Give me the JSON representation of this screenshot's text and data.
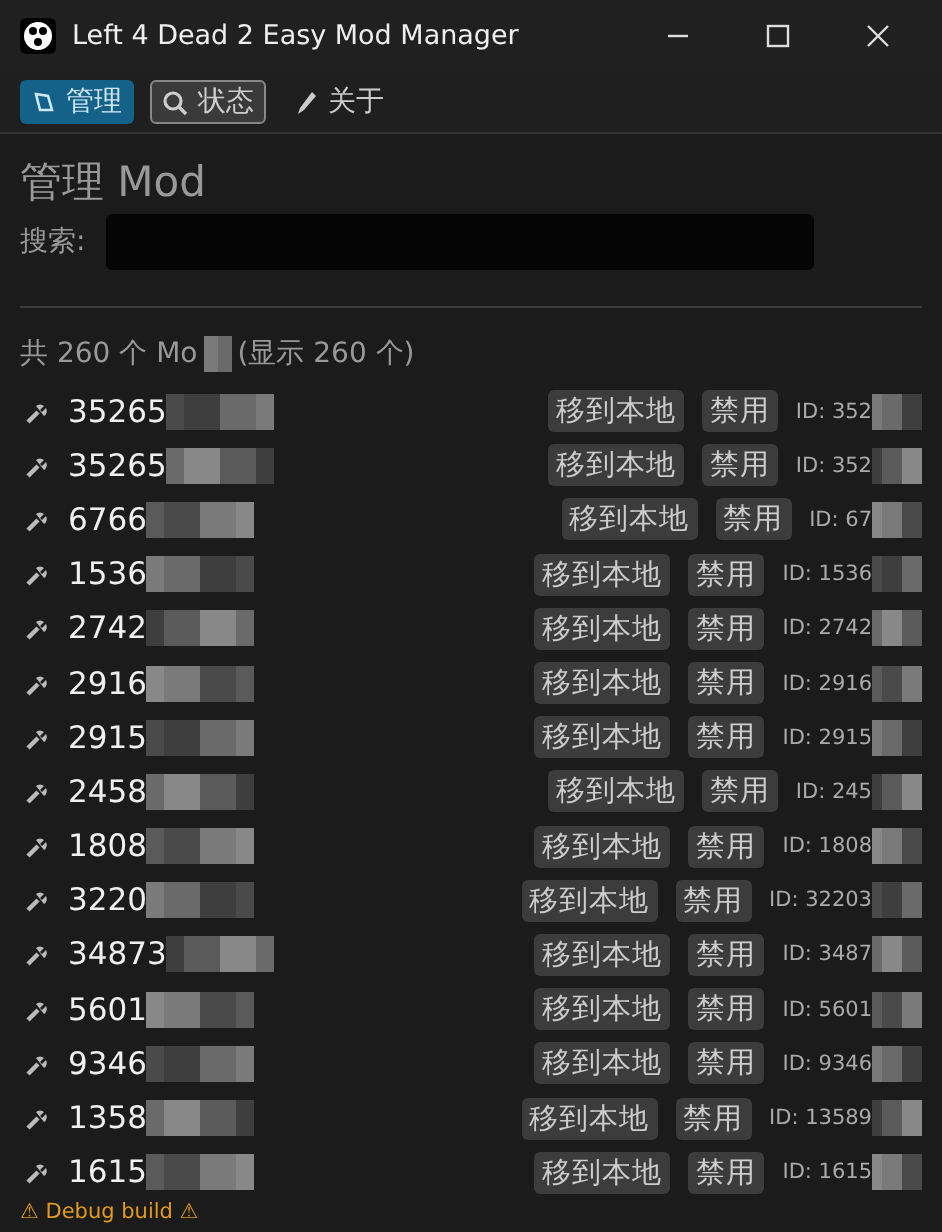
{
  "window": {
    "title": "Left 4 Dead 2 Easy Mod Manager"
  },
  "tabs": [
    {
      "label": "管理",
      "selected": true,
      "focused": false,
      "kind": "folder"
    },
    {
      "label": "状态",
      "selected": false,
      "focused": true,
      "kind": "search"
    },
    {
      "label": "关于",
      "selected": false,
      "focused": false,
      "kind": "pen"
    }
  ],
  "heading": "管理 Mod",
  "search": {
    "label": "搜索:"
  },
  "summary": "共 260 个 Mo",
  "summary_tail": "(显示 260 个)",
  "mods": [
    {
      "name": "35265",
      "move_button": "移到本地",
      "disable_button": "禁用",
      "id": "ID: 352"
    },
    {
      "name": "35265",
      "move_button": "移到本地",
      "disable_button": "禁用",
      "id": "ID: 352"
    },
    {
      "name": "6766",
      "move_button": "移到本地",
      "disable_button": "禁用",
      "id": "ID: 67"
    },
    {
      "name": "1536",
      "move_button": "移到本地",
      "disable_button": "禁用",
      "id": "ID: 1536"
    },
    {
      "name": "2742",
      "move_button": "移到本地",
      "disable_button": "禁用",
      "id": "ID: 2742"
    },
    {
      "name": "2916",
      "move_button": "移到本地",
      "disable_button": "禁用",
      "id": "ID: 2916"
    },
    {
      "name": "2915",
      "move_button": "移到本地",
      "disable_button": "禁用",
      "id": "ID: 2915"
    },
    {
      "name": "2458",
      "move_button": "移到本地",
      "disable_button": "禁用",
      "id": "ID: 245"
    },
    {
      "name": "1808",
      "move_button": "移到本地",
      "disable_button": "禁用",
      "id": "ID: 1808"
    },
    {
      "name": "3220",
      "move_button": "移到本地",
      "disable_button": "禁用",
      "id": "ID: 32203"
    },
    {
      "name": "34873",
      "move_button": "移到本地",
      "disable_button": "禁用",
      "id": "ID: 3487"
    },
    {
      "name": "5601",
      "move_button": "移到本地",
      "disable_button": "禁用",
      "id": "ID: 5601"
    },
    {
      "name": "9346",
      "move_button": "移到本地",
      "disable_button": "禁用",
      "id": "ID: 9346"
    },
    {
      "name": "1358",
      "move_button": "移到本地",
      "disable_button": "禁用",
      "id": "ID: 13589"
    },
    {
      "name": "1615",
      "move_button": "移到本地",
      "disable_button": "禁用",
      "id": "ID: 1615"
    }
  ],
  "footer": "⚠ Debug build ⚠"
}
